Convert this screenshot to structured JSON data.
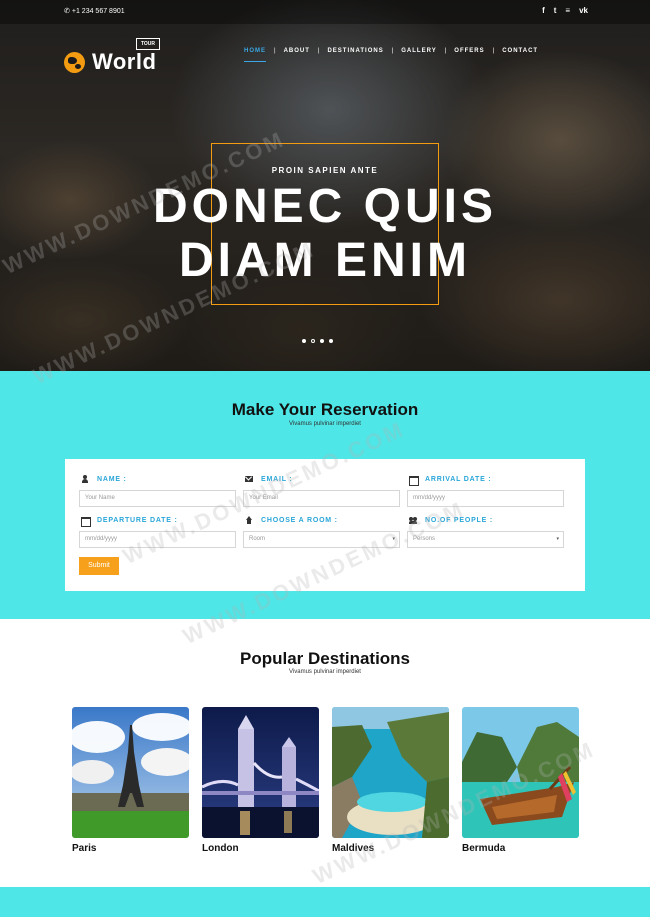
{
  "topbar": {
    "phone": "+1 234 567 8901",
    "socials": [
      {
        "icon": "facebook-icon",
        "glyph": "f"
      },
      {
        "icon": "twitter-icon",
        "glyph": "t"
      },
      {
        "icon": "rss-icon",
        "glyph": "≡"
      },
      {
        "icon": "vk-icon",
        "glyph": "vk"
      }
    ]
  },
  "brand": {
    "name": "World",
    "tag": "TOUR",
    "accent": "#f39c12"
  },
  "nav": {
    "items": [
      "HOME",
      "ABOUT",
      "DESTINATIONS",
      "GALLERY",
      "OFFERS",
      "CONTACT"
    ],
    "active": "HOME",
    "active_color": "#3aa8e6"
  },
  "hero": {
    "subtitle": "PROIN SAPIEN ANTE",
    "title_line1": "DONEC QUIS",
    "title_line2": "DIAM ENIM",
    "slides": 4,
    "active_slide": 2
  },
  "reservation": {
    "title": "Make Your Reservation",
    "subtitle": "Vivamus pulvinar imperdiet",
    "background": "#4ee6e6",
    "fields": {
      "name": {
        "label": "NAME :",
        "placeholder": "Your Name"
      },
      "email": {
        "label": "EMAIL :",
        "placeholder": "Your Email"
      },
      "arrival": {
        "label": "ARRIVAL DATE :",
        "placeholder": "mm/dd/yyyy"
      },
      "departure": {
        "label": "DEPARTURE DATE :",
        "placeholder": "mm/dd/yyyy"
      },
      "room": {
        "label": "CHOOSE A ROOM :",
        "value": "Room"
      },
      "people": {
        "label": "NO.OF PEOPLE :",
        "value": "Persons"
      }
    },
    "submit": "Submit",
    "submit_color": "#f7a01b"
  },
  "destinations": {
    "title": "Popular Destinations",
    "subtitle": "Vivamus pulvinar imperdiet",
    "items": [
      {
        "name": "Paris"
      },
      {
        "name": "London"
      },
      {
        "name": "Maldives"
      },
      {
        "name": "Bermuda"
      }
    ]
  },
  "watermark": "WWW.DOWNDEMO.COM"
}
